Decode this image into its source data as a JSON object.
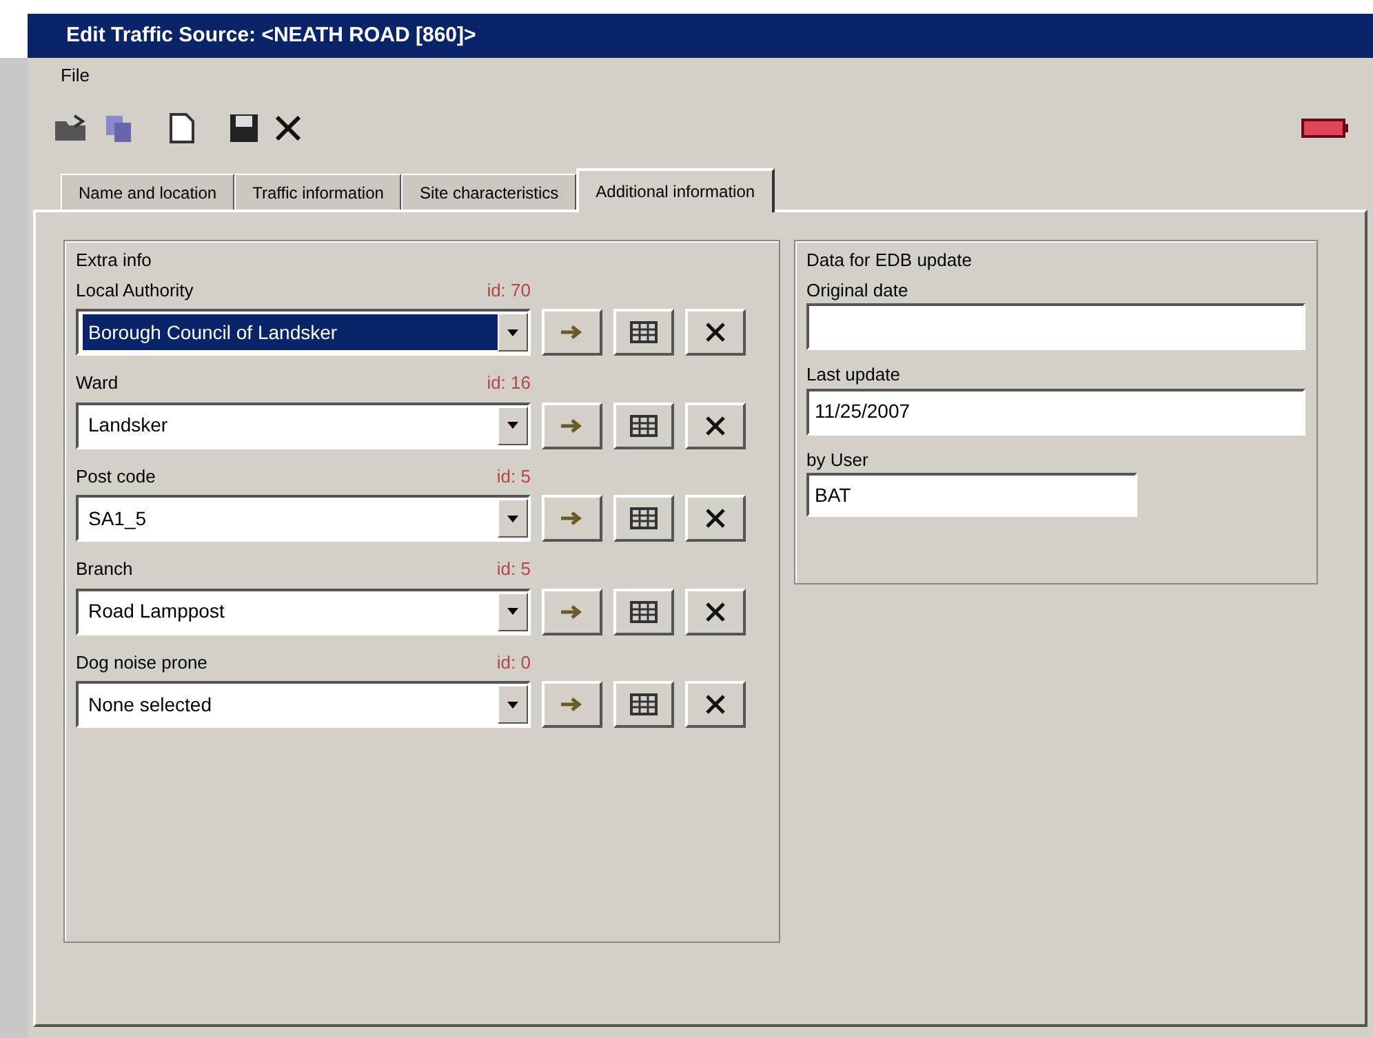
{
  "window": {
    "title": "Edit Traffic Source: <NEATH ROAD [860]>"
  },
  "menu": [
    "File"
  ],
  "tabs": [
    {
      "label": "Name and location",
      "selected": false
    },
    {
      "label": "Traffic information",
      "selected": false
    },
    {
      "label": "Site characteristics",
      "selected": false
    },
    {
      "label": "Additional information",
      "selected": true
    }
  ],
  "extra_info": {
    "title": "Extra info",
    "fields": [
      {
        "label": "Local Authority",
        "tag": "id: 70",
        "value": "Borough Council of Landsker",
        "selected": true
      },
      {
        "label": "Ward",
        "tag": "id: 16",
        "value": "Landsker",
        "selected": false
      },
      {
        "label": "Post code",
        "tag": "id: 5",
        "value": "SA1_5",
        "selected": false
      },
      {
        "label": "Branch",
        "tag": "id: 5",
        "value": "Road Lamppost",
        "selected": false
      },
      {
        "label": "Dog noise prone",
        "tag": "id: 0",
        "value": "None selected",
        "selected": false
      }
    ]
  },
  "edb_update": {
    "title": "Data for EDB update",
    "original_date": {
      "label": "Original date"
    },
    "last_update": {
      "label": "Last update",
      "value": "11/25/2007"
    },
    "by_user": {
      "label": "by User",
      "value": "BAT"
    }
  }
}
